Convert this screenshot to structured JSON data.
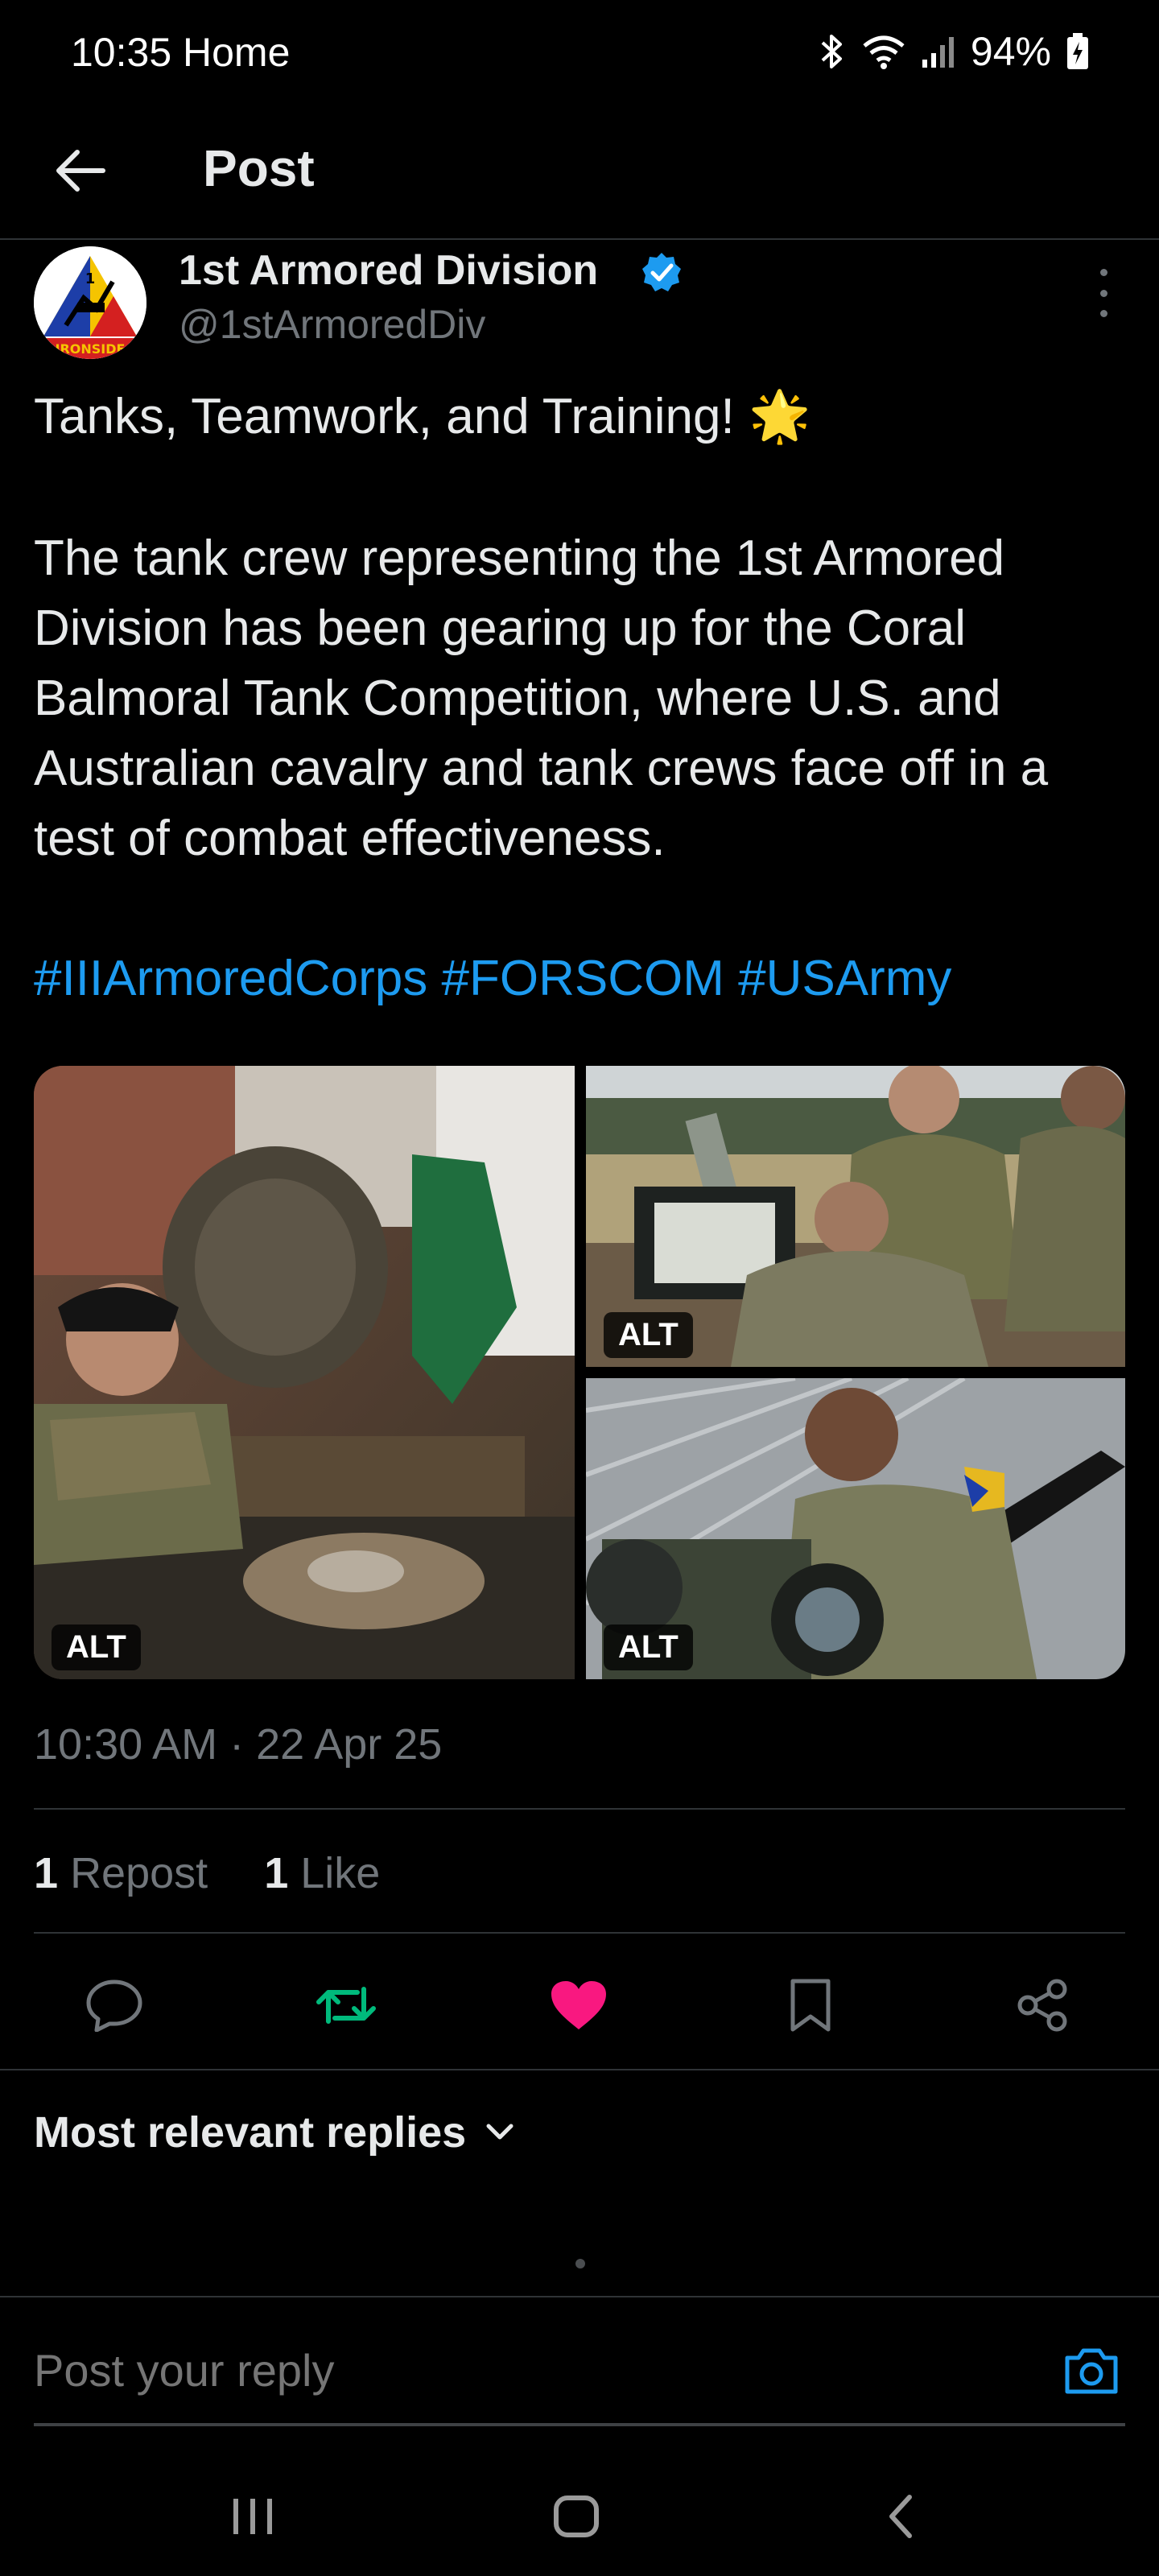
{
  "status_bar": {
    "time": "10:35 Home",
    "battery": "94%",
    "icons": [
      "bluetooth-icon",
      "wifi-icon",
      "signal-icon",
      "battery-icon"
    ]
  },
  "header": {
    "title": "Post",
    "back_icon": "back-arrow-icon"
  },
  "post": {
    "author_name": "1st Armored Division",
    "author_handle": "@1stArmoredDiv",
    "avatar_text": "IRONSIDE",
    "text_line1": "Tanks, Teamwork, and Training! 🌟",
    "text_body": "The tank crew representing the 1st Armored Division has been gearing up for the Coral Balmoral Tank Competition, where U.S. and Australian cavalry and tank crews face off in a test of combat effectiveness.",
    "hashtags": "#IIIArmoredCorps #FORSCOM #USArmy",
    "media": [
      {
        "alt_label": "ALT"
      },
      {
        "alt_label": "ALT"
      },
      {
        "alt_label": "ALT"
      }
    ],
    "timestamp": "10:30 AM · 22 Apr 25",
    "stats": {
      "reposts_count": "1",
      "reposts_label": "Repost",
      "likes_count": "1",
      "likes_label": "Like"
    }
  },
  "actions": {
    "reply_icon": "reply-icon",
    "repost_icon": "repost-icon",
    "like_icon": "heart-icon",
    "bookmark_icon": "bookmark-icon",
    "share_icon": "share-icon"
  },
  "colors": {
    "accent": "#1d9bf0",
    "repost": "#00ba7c",
    "like": "#f91880",
    "muted": "#71767b"
  },
  "replies": {
    "sort_label": "Most relevant replies"
  },
  "composer": {
    "placeholder": "Post your reply"
  }
}
